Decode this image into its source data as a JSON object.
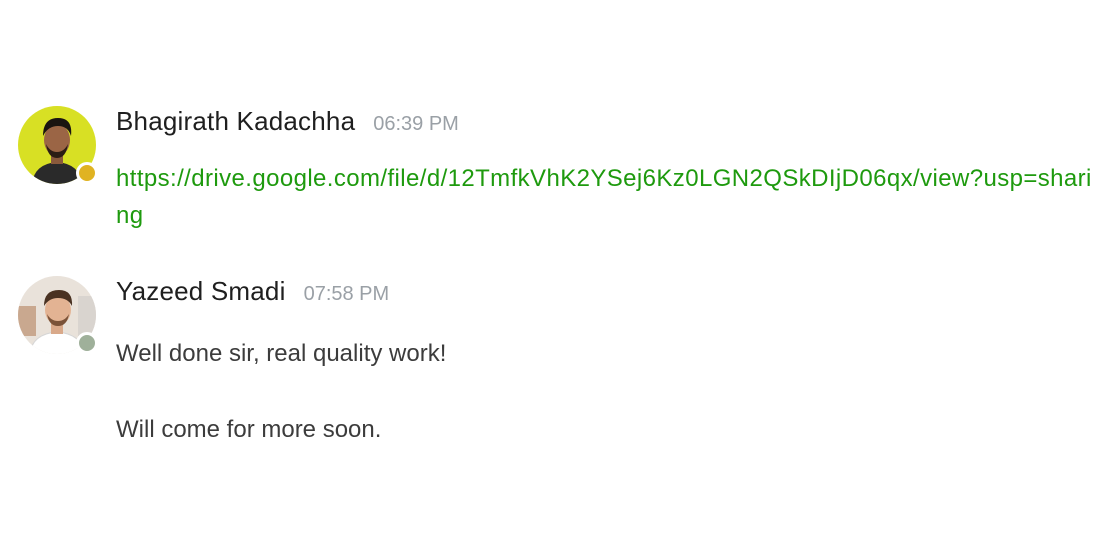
{
  "messages": [
    {
      "sender": "Bhagirath Kadachha",
      "time": "06:39 PM",
      "link": "https://drive.google.com/file/d/12TmfkVhK2YSej6Kz0LGN2QSkDIjD06qx/view?usp=sharing",
      "presence_color": "#e0b322",
      "avatar_bg": "#d8e024"
    },
    {
      "sender": "Yazeed Smadi",
      "time": "07:58 PM",
      "lines": [
        "Well done sir, real quality work!",
        "Will come for more soon."
      ],
      "presence_color": "#9fb09a",
      "avatar_bg": "#e9e2da"
    }
  ]
}
